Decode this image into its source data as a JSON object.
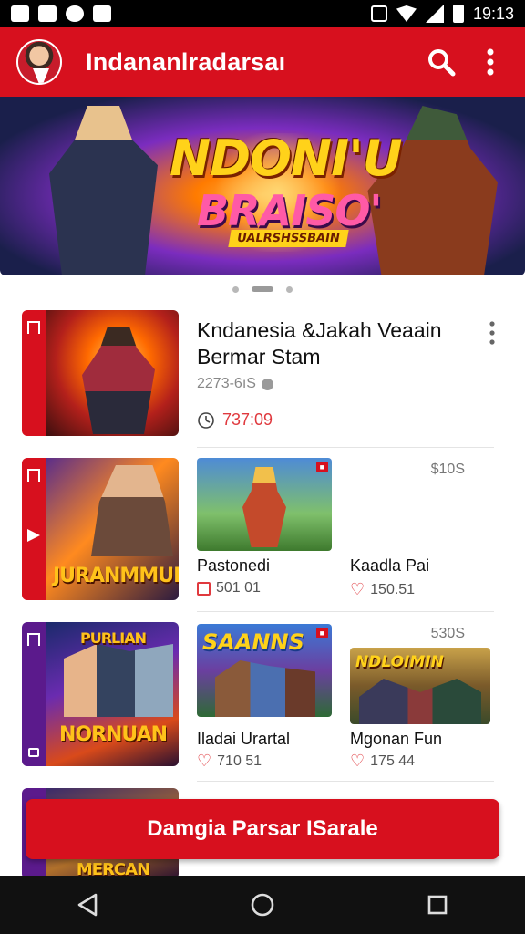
{
  "status_bar": {
    "time": "19:13"
  },
  "app_bar": {
    "title": "Indananlradarsaı"
  },
  "banner": {
    "title": "NDONI'U",
    "subtitle": "BRAISO'",
    "tag": "UALRSHSSBAIN"
  },
  "list": {
    "featured": {
      "title": "Kndanesia &Jakah Veaain Bermar Stam",
      "meta": "2273-6ıS",
      "time": "737:09"
    },
    "row2": {
      "cover_text": "JURANMMUN",
      "price": "$10S",
      "items": [
        {
          "title": "Pastonedi",
          "stat": "501 01"
        },
        {
          "title": "Kaadla Pai",
          "stat": "150.51"
        }
      ]
    },
    "row3": {
      "cover_text_top": "PURLIAN",
      "cover_text": "NORNUAN",
      "price": "530S",
      "items": [
        {
          "title": "Iladai Urartal",
          "stat": "710 51",
          "thumb_text": "SAANNS"
        },
        {
          "title": "Mgonan Fun",
          "stat": "175 44",
          "thumb_text": "NDLOIMIN"
        }
      ]
    },
    "row4": {
      "cover_text": "MERCAN"
    }
  },
  "cta": {
    "label": "Damgia Parsar ISarale"
  },
  "colors": {
    "accent": "#d7101e",
    "purple": "#5b1a8c",
    "time_red": "#e0393e"
  }
}
